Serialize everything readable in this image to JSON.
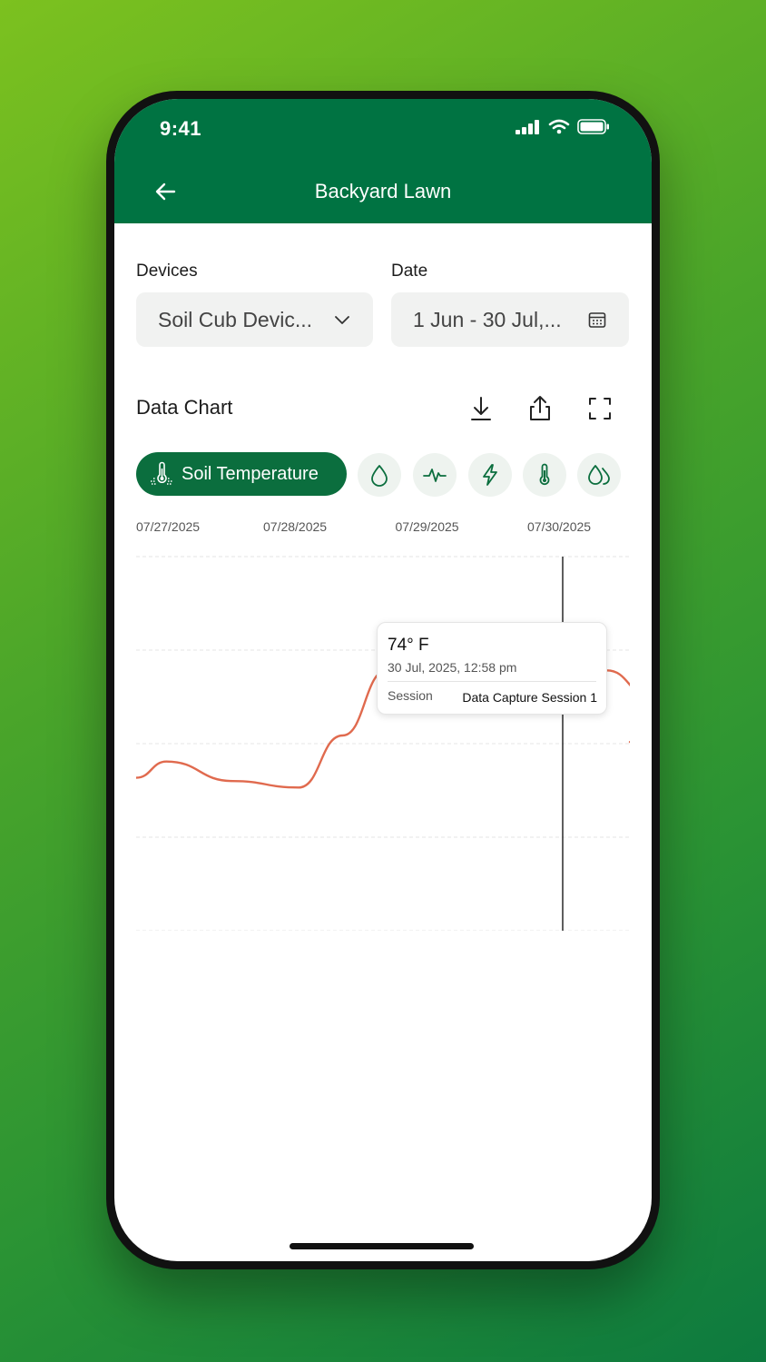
{
  "status": {
    "time": "9:41"
  },
  "header": {
    "title": "Backyard Lawn"
  },
  "filters": {
    "devices_label": "Devices",
    "devices_value": "Soil Cub Devic...",
    "date_label": "Date",
    "date_value": "1 Jun - 30 Jul,..."
  },
  "chart_section": {
    "title": "Data Chart",
    "active_metric": "Soil Temperature"
  },
  "icons": {
    "back": "arrow-left-icon",
    "download": "download-icon",
    "share": "share-icon",
    "fullscreen": "fullscreen-icon",
    "metrics": [
      "soil-temperature-icon",
      "water-drop-icon",
      "pulse-icon",
      "lightning-icon",
      "thermometer-icon",
      "double-drop-icon"
    ]
  },
  "chart_data": {
    "type": "line",
    "x_labels": [
      "07/27/2025",
      "07/28/2025",
      "07/29/2025",
      "07/30/2025"
    ],
    "series": [
      {
        "name": "Soil Temperature",
        "color": "#e06a4e",
        "points": [
          [
            "07/26/2025",
            70.7
          ],
          [
            "07/27/2025",
            71.2
          ],
          [
            "07/27/2025",
            70.6
          ],
          [
            "07/28/2025",
            70.4
          ],
          [
            "07/28/2025",
            72.0
          ],
          [
            "07/28/2025",
            74.0
          ],
          [
            "07/29/2025",
            74.3
          ],
          [
            "07/29/2025",
            73.6
          ],
          [
            "07/29/2025",
            73.9
          ],
          [
            "07/30/2025",
            73.3
          ],
          [
            "07/30/2025",
            74.0
          ],
          [
            "07/30/2025",
            73.2
          ],
          [
            "07/31/2025",
            71.8
          ]
        ]
      }
    ],
    "highlight": {
      "x": "07/30/2025",
      "value_label": "74° F",
      "datetime": "30 Jul, 2025, 12:58 pm",
      "session_label": "Session",
      "session_value": "Data Capture Session 1"
    }
  },
  "colors": {
    "primary": "#007342",
    "line": "#e06a4e"
  }
}
